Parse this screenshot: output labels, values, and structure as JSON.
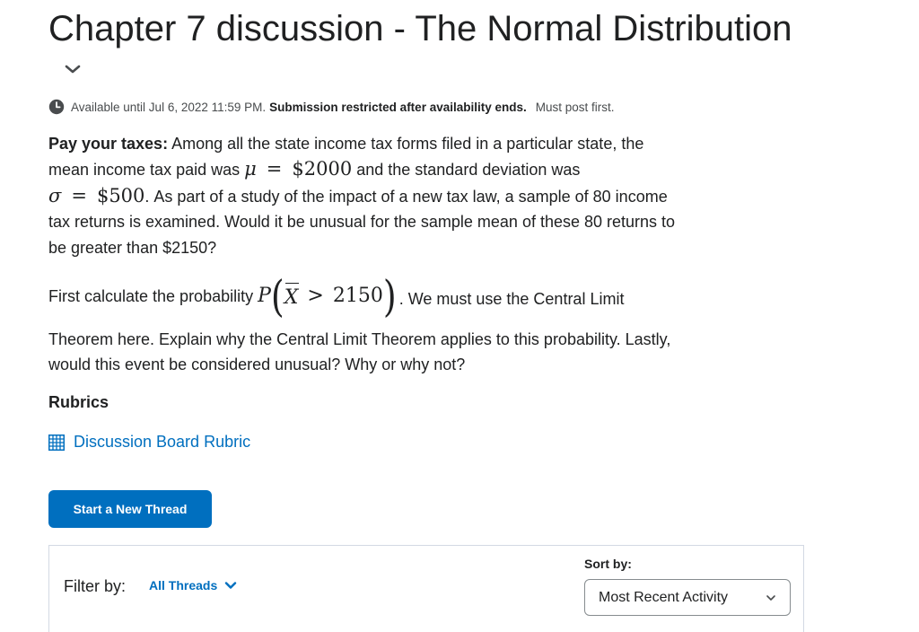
{
  "page_title": "Chapter 7 discussion - The Normal Distribution",
  "availability": {
    "icon": "clock-icon",
    "available_text": "Available until Jul 6, 2022 11:59 PM.",
    "restriction_text": "Submission restricted after availability ends.",
    "post_first_text": "Must post first."
  },
  "question": {
    "lead": "Pay your taxes:",
    "text1": "Among all the state income tax forms filed in a particular state, the mean income tax paid was",
    "mu_symbol": "μ",
    "equals": "=",
    "mean_value": "$2000",
    "text2": "and the standard deviation was",
    "sigma_symbol": "σ",
    "sd_value": "$500",
    "text3": ". As part of a study of the impact of a new tax law, a sample of 80 income tax returns is examined. Would it be unusual for the sample mean of these 80 returns to be greater than $2150?"
  },
  "probability_prompt": {
    "text_before": "First calculate the probability",
    "p_symbol": "P",
    "open_paren": "(",
    "x_symbol": "X",
    "gt": ">",
    "threshold": "2150",
    "close_paren": ")",
    "text_after": ". We must use the Central Limit",
    "text_rest": "Theorem here. Explain why the Central Limit Theorem applies to this probability. Lastly, would this event be considered unusual? Why or why not?"
  },
  "rubrics": {
    "heading": "Rubrics",
    "link_label": "Discussion Board Rubric",
    "link_icon": "rubric-grid-icon"
  },
  "new_thread_button": "Start a New Thread",
  "thread_controls": {
    "filter_label": "Filter by:",
    "filter_value": "All Threads",
    "sort_label": "Sort by:",
    "sort_value": "Most Recent Activity"
  },
  "colors": {
    "accent": "#006fbf",
    "text": "#202122",
    "muted_text": "#494c4e",
    "border": "#d3d9e3"
  }
}
